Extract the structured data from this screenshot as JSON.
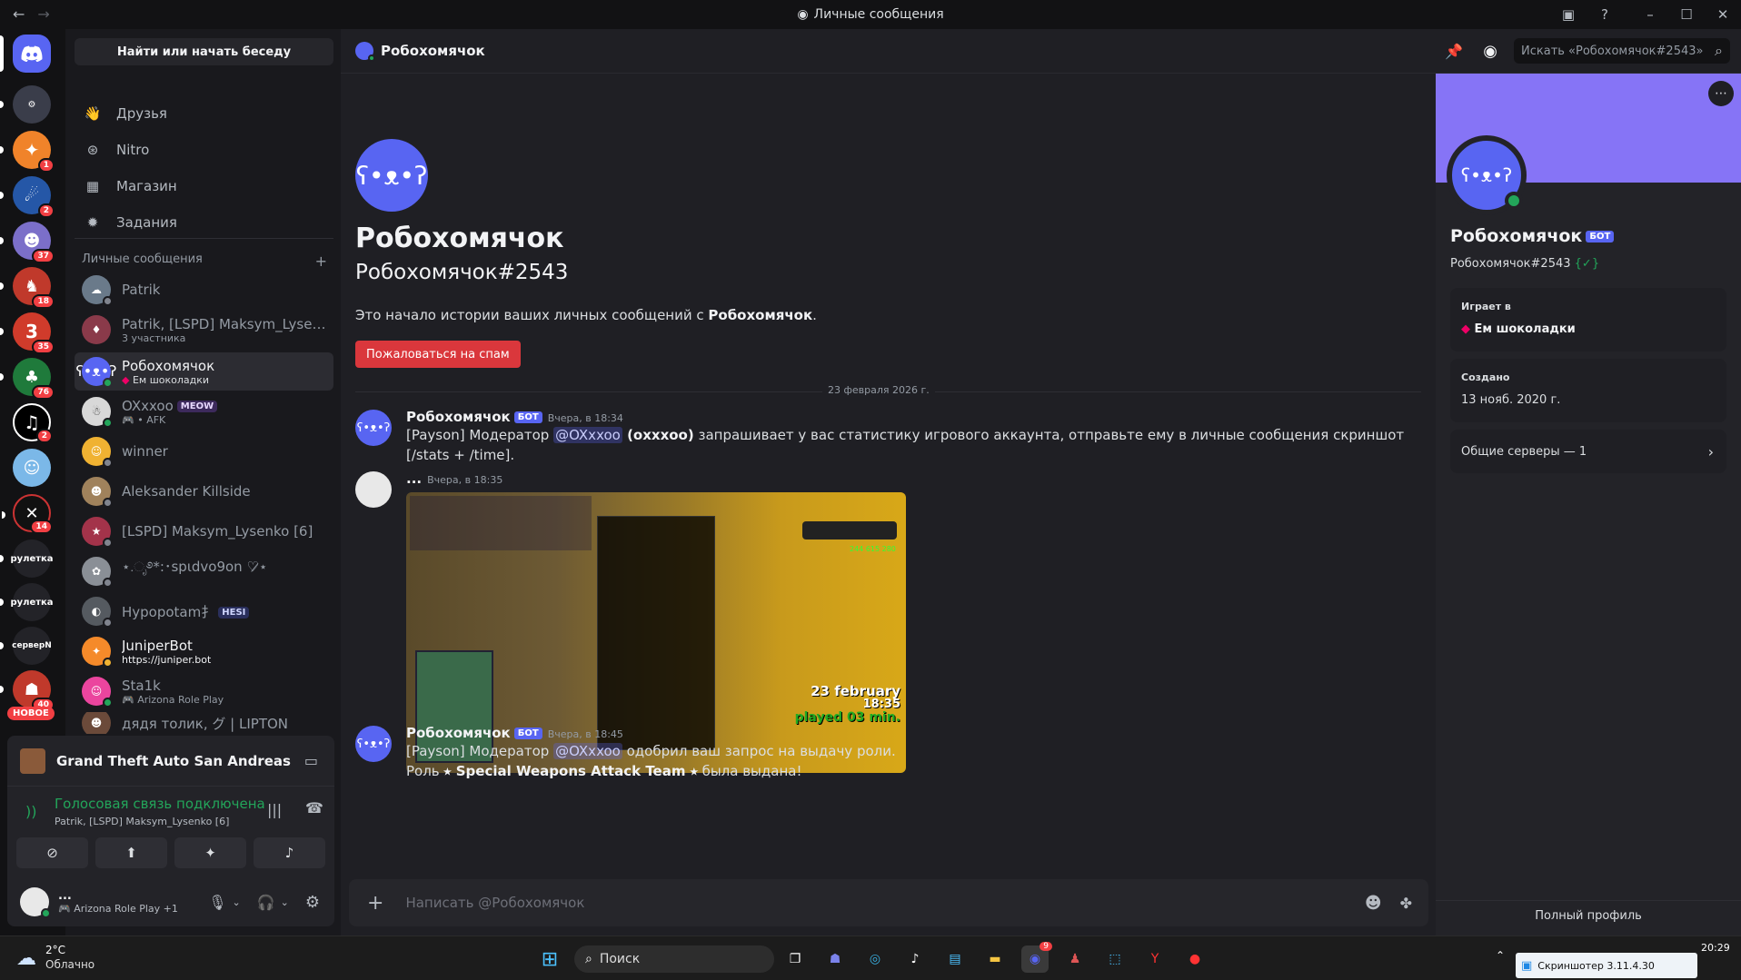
{
  "window": {
    "title": "Личные сообщения"
  },
  "servers": {
    "badges": [
      "",
      "1",
      "2",
      "37",
      "18",
      "35",
      "76",
      "2",
      "",
      "14",
      "",
      "",
      "",
      "40",
      ""
    ],
    "labels": {
      "ruletka1": "рулетка",
      "ruletka2": "рулетка",
      "server": "серверN",
      "new": "НОВОЕ"
    }
  },
  "sidebar": {
    "search": "Найти или начать беседу",
    "nav": [
      "Друзья",
      "Nitro",
      "Магазин",
      "Задания"
    ],
    "dm_header": "Личные сообщения",
    "dms": [
      {
        "name": "Patrik",
        "sub": ""
      },
      {
        "name": "Patrik, [LSPD] Maksym_Lysenk...",
        "sub": "3 участника"
      },
      {
        "name": "Робохомячок",
        "sub": "Ем шоколадки"
      },
      {
        "name": "OXxxoo",
        "sub": "• AFK",
        "tag": "MEOW"
      },
      {
        "name": "winner",
        "sub": ""
      },
      {
        "name": "Aleksander Killside",
        "sub": ""
      },
      {
        "name": "[LSPD] Maksym_Lysenko [6]",
        "sub": ""
      },
      {
        "name": "⋆.ೃ࿔*:･spιdvo9on ♡̷⋆",
        "sub": ""
      },
      {
        "name": "Hypopotam⺘",
        "sub": "",
        "tag": "HESI"
      },
      {
        "name": "JuniperBot",
        "sub": "https://juniper.bot"
      },
      {
        "name": "Sta1k",
        "sub": "Arizona Role Play"
      },
      {
        "name": "дядя толик, グ | LIPTON",
        "sub": ""
      }
    ]
  },
  "panel": {
    "game": "Grand Theft Auto San Andreas",
    "voice_status": "Голосовая связь подключена",
    "voice_channel": "Patrik, [LSPD] Maksym_Lysenko [6]",
    "user_name": "...",
    "user_status": "Arizona Role Play +1"
  },
  "header": {
    "name": "Робохомячок",
    "search_placeholder": "Искать «Робохомячок#2543»"
  },
  "intro": {
    "name": "Робохомячок",
    "tag": "Робохомячок#2543",
    "text_prefix": "Это начало истории ваших личных сообщений с ",
    "text_bold": "Робохомячок",
    "text_suffix": ".",
    "spam_button": "Пожаловаться на спам"
  },
  "date_divider": "23 февраля 2026 г.",
  "messages": [
    {
      "author": "Робохомячок",
      "bot": "БОТ",
      "time": "Вчера, в 18:34",
      "p1": "[Payson] Модератор ",
      "mention": "@OXxxoo",
      "p2": " (oxxxoo)",
      "p3": " запрашивает у вас статистику игрового аккаунта, отправьте ему в личные сообщения скриншот [/stats + /time]."
    },
    {
      "author": "...",
      "time": "Вчера, в 18:35",
      "image_text": {
        "date": "23 february",
        "clock": "18:35",
        "played": "played 03 min.",
        "money": "244 615 280"
      }
    },
    {
      "author": "Робохомячок",
      "bot": "БОТ",
      "time": "Вчера, в 18:45",
      "p1": "[Payson] Модератор ",
      "mention": "@OXxxoo",
      "p3": " одобрил ваш запрос на выдачу роли.",
      "line2_a": "Роль ",
      "line2_b": "⭑ Special Weapons Attack Team ⭑",
      "line2_c": " была выдана!"
    }
  ],
  "composer": {
    "placeholder": "Написать @Робохомячок"
  },
  "profile": {
    "name": "Робохомячок",
    "bot": "БОТ",
    "tag": "Робохомячок#2543",
    "verified": "{✓}",
    "playing_label": "Играет в",
    "playing": "Ем шоколадки",
    "created_label": "Создано",
    "created": "13 нояб. 2020 г.",
    "mutual": "Общие серверы — 1",
    "full_profile": "Полный профиль"
  },
  "taskbar": {
    "weather_temp": "2°C",
    "weather_text": "Облачно",
    "search": "Поиск",
    "discord_badge": "9",
    "notify": "Скриншотер 3.11.4.30",
    "clock": "20:29"
  },
  "colors": {
    "accent": "#5865f2",
    "danger": "#da373c",
    "online": "#23a55a",
    "banner": "#8674f6"
  }
}
